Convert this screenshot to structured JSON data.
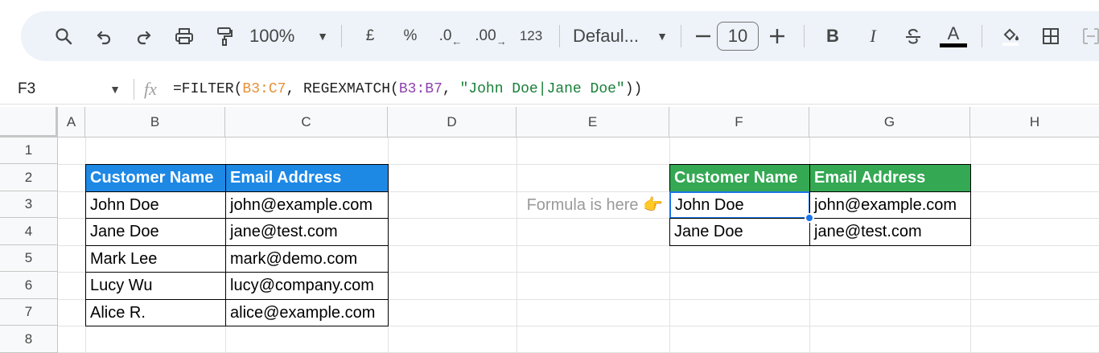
{
  "toolbar": {
    "zoom": "100%",
    "currency": "£",
    "percent": "%",
    "decrease_decimal": ".0",
    "increase_decimal": ".00",
    "number_format": "123",
    "font": "Defaul...",
    "font_size": "10",
    "bold": "B",
    "italic": "I",
    "strike": "S",
    "text_color": "A"
  },
  "formula_bar": {
    "cell_ref": "F3",
    "fx": "fx",
    "formula_prefix": "=FILTER(",
    "range1": "B3:C7",
    "formula_mid": ", REGEXMATCH(",
    "range2": "B3:B7",
    "formula_sep": ", ",
    "pattern": "\"John Doe|Jane Doe\"",
    "formula_suffix": "))"
  },
  "columns": [
    "A",
    "B",
    "C",
    "D",
    "E",
    "F",
    "G",
    "H"
  ],
  "rows": [
    "1",
    "2",
    "3",
    "4",
    "5",
    "6",
    "7",
    "8"
  ],
  "source_table": {
    "headers": [
      "Customer Name",
      "Email Address"
    ],
    "rows": [
      [
        "John Doe",
        "john@example.com"
      ],
      [
        "Jane Doe",
        "jane@test.com"
      ],
      [
        "Mark Lee",
        "mark@demo.com"
      ],
      [
        "Lucy Wu",
        "lucy@company.com"
      ],
      [
        "Alice R.",
        "alice@example.com"
      ]
    ]
  },
  "note": "Formula is here 👉",
  "result_table": {
    "headers": [
      "Customer Name",
      "Email Address"
    ],
    "rows": [
      [
        "John Doe",
        "john@example.com"
      ],
      [
        "Jane Doe",
        "jane@test.com"
      ]
    ]
  },
  "colors": {
    "source_header": "#1e88e5",
    "result_header": "#34a853",
    "selection": "#1a73e8"
  }
}
